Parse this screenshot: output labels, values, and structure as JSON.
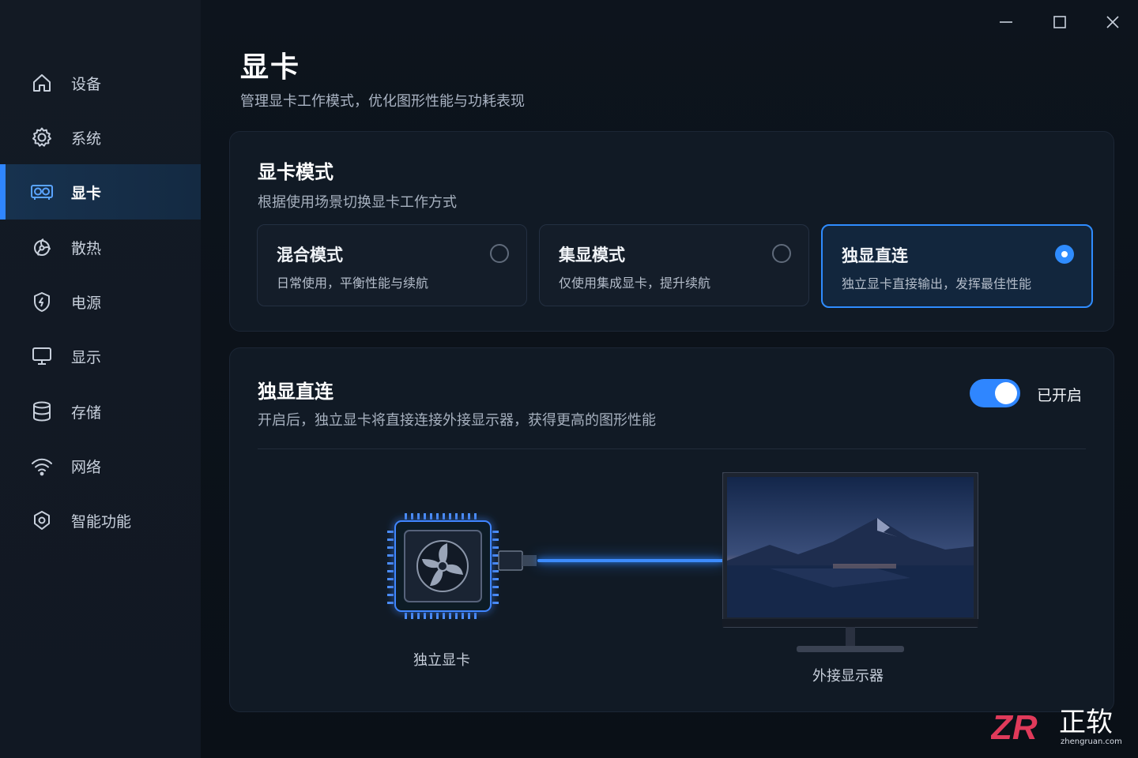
{
  "window": {
    "minimize_icon": "minimize-icon",
    "maximize_icon": "maximize-icon",
    "close_icon": "close-icon"
  },
  "sidebar": {
    "items": [
      {
        "label": "设备",
        "icon": "home-icon"
      },
      {
        "label": "系统",
        "icon": "gear-icon"
      },
      {
        "label": "显卡",
        "icon": "gpu-icon",
        "active": true
      },
      {
        "label": "散热",
        "icon": "fan-icon"
      },
      {
        "label": "电源",
        "icon": "power-icon"
      },
      {
        "label": "显示",
        "icon": "monitor-icon"
      },
      {
        "label": "存储",
        "icon": "database-icon"
      },
      {
        "label": "网络",
        "icon": "wifi-icon"
      },
      {
        "label": "智能功能",
        "icon": "smart-icon"
      }
    ]
  },
  "header": {
    "title": "显卡",
    "subtitle": "管理显卡工作模式，优化图形性能与功耗表现"
  },
  "mode_card": {
    "title": "显卡模式",
    "subtitle": "根据使用场景切换显卡工作方式",
    "options": [
      {
        "title": "混合模式",
        "desc": "日常使用，平衡性能与续航",
        "selected": false
      },
      {
        "title": "集显模式",
        "desc": "仅使用集成显卡，提升续航",
        "selected": false
      },
      {
        "title": "独显直连",
        "desc": "独立显卡直接输出，发挥最佳性能",
        "selected": true
      }
    ]
  },
  "direct_card": {
    "title": "独显直连",
    "subtitle": "开启后，独立显卡将直接连接外接显示器，获得更高的图形性能",
    "toggle_on": true,
    "toggle_label": "已开启",
    "gpu_caption": "独立显卡",
    "monitor_caption": "外接显示器"
  },
  "watermark": {
    "brand": "正软",
    "logo": "ZR",
    "url": "zhengruan.com"
  },
  "colors": {
    "accent": "#2f86ff",
    "background": "#0b1119",
    "card": "#111a25"
  }
}
